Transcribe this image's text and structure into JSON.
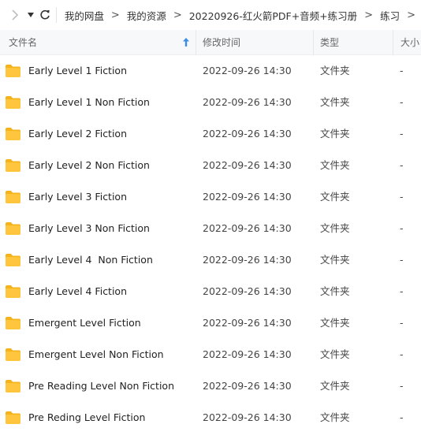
{
  "colors": {
    "folder": "#ffc53d",
    "folder_tab": "#f4b21c",
    "accent": "#3a8ee6"
  },
  "nav": {
    "forward_icon": "chevron-right-icon",
    "dropdown_icon": "caret-down-icon",
    "refresh_icon": "refresh-icon"
  },
  "breadcrumb": [
    "我的网盘",
    "我的资源",
    "20220926-红火箭PDF+音频+练习册",
    "练习"
  ],
  "breadcrumb_sep": ">",
  "columns": {
    "name": "文件名",
    "date": "修改时间",
    "type": "类型",
    "size": "大小"
  },
  "rows": [
    {
      "name": "Early Level 1 Fiction",
      "date": "2022-09-26 14:30",
      "type": "文件夹",
      "size": "-"
    },
    {
      "name": "Early Level 1 Non Fiction",
      "date": "2022-09-26 14:30",
      "type": "文件夹",
      "size": "-"
    },
    {
      "name": "Early Level 2 Fiction",
      "date": "2022-09-26 14:30",
      "type": "文件夹",
      "size": "-"
    },
    {
      "name": "Early Level 2 Non Fiction",
      "date": "2022-09-26 14:30",
      "type": "文件夹",
      "size": "-"
    },
    {
      "name": "Early Level 3 Fiction",
      "date": "2022-09-26 14:30",
      "type": "文件夹",
      "size": "-"
    },
    {
      "name": "Early Level 3 Non Fiction",
      "date": "2022-09-26 14:30",
      "type": "文件夹",
      "size": "-"
    },
    {
      "name": "Early Level 4  Non Fiction",
      "date": "2022-09-26 14:30",
      "type": "文件夹",
      "size": "-"
    },
    {
      "name": "Early Level 4 Fiction",
      "date": "2022-09-26 14:30",
      "type": "文件夹",
      "size": "-"
    },
    {
      "name": "Emergent Level Fiction",
      "date": "2022-09-26 14:30",
      "type": "文件夹",
      "size": "-"
    },
    {
      "name": "Emergent Level Non Fiction",
      "date": "2022-09-26 14:30",
      "type": "文件夹",
      "size": "-"
    },
    {
      "name": "Pre Reading Level Non Fiction",
      "date": "2022-09-26 14:30",
      "type": "文件夹",
      "size": "-"
    },
    {
      "name": "Pre Reding Level Fiction",
      "date": "2022-09-26 14:30",
      "type": "文件夹",
      "size": "-"
    }
  ]
}
